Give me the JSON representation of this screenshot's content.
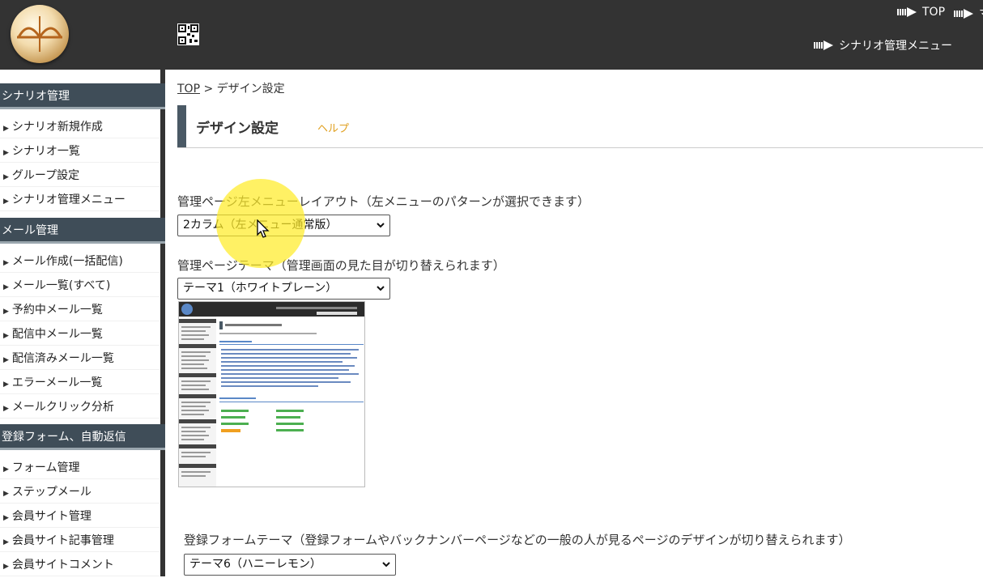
{
  "header": {
    "top_link": "TOP",
    "top_link_2": "マ",
    "scenario_menu_link": "シナリオ管理メニュー"
  },
  "sidebar": {
    "sections": [
      {
        "title": "シナリオ管理",
        "items": [
          "シナリオ新規作成",
          "シナリオ一覧",
          "グループ設定",
          "シナリオ管理メニュー"
        ]
      },
      {
        "title": "メール管理",
        "items": [
          "メール作成(一括配信)",
          "メール一覧(すべて)",
          "予約中メール一覧",
          "配信中メール一覧",
          "配信済みメール一覧",
          "エラーメール一覧",
          "メールクリック分析"
        ]
      },
      {
        "title": "登録フォーム、自動返信",
        "items": [
          "フォーム管理",
          "ステップメール",
          "会員サイト管理",
          "会員サイト記事管理",
          "会員サイトコメント"
        ]
      }
    ]
  },
  "breadcrumb": {
    "top": "TOP",
    "separator": ">",
    "current": "デザイン設定"
  },
  "page": {
    "title": "デザイン設定",
    "help": "ヘルプ"
  },
  "settings": {
    "left_menu_layout": {
      "label": "管理ページ左メニューレイアウト（左メニューのパターンが選択できます）",
      "value": "2カラム（左メニュー通常版）"
    },
    "admin_theme": {
      "label": "管理ページテーマ（管理画面の見た目が切り替えられます）",
      "value": "テーマ1（ホワイトプレーン）"
    },
    "form_theme": {
      "label": "登録フォームテーマ（登録フォームやバックナンバーページなどの一般の人が見るページのデザインが切り替えられます）",
      "value": "テーマ6（ハニーレモン）"
    }
  },
  "icons": {
    "logo": "logo-icon",
    "qr": "qr-code-icon",
    "arrow": "arrow-right-icon",
    "chevron": "chevron-down-icon",
    "cursor": "mouse-pointer-icon"
  },
  "colors": {
    "header_bg": "#333333",
    "section_bg": "#3f4d58",
    "help": "#e0a020",
    "highlight": "#ffeb28"
  }
}
